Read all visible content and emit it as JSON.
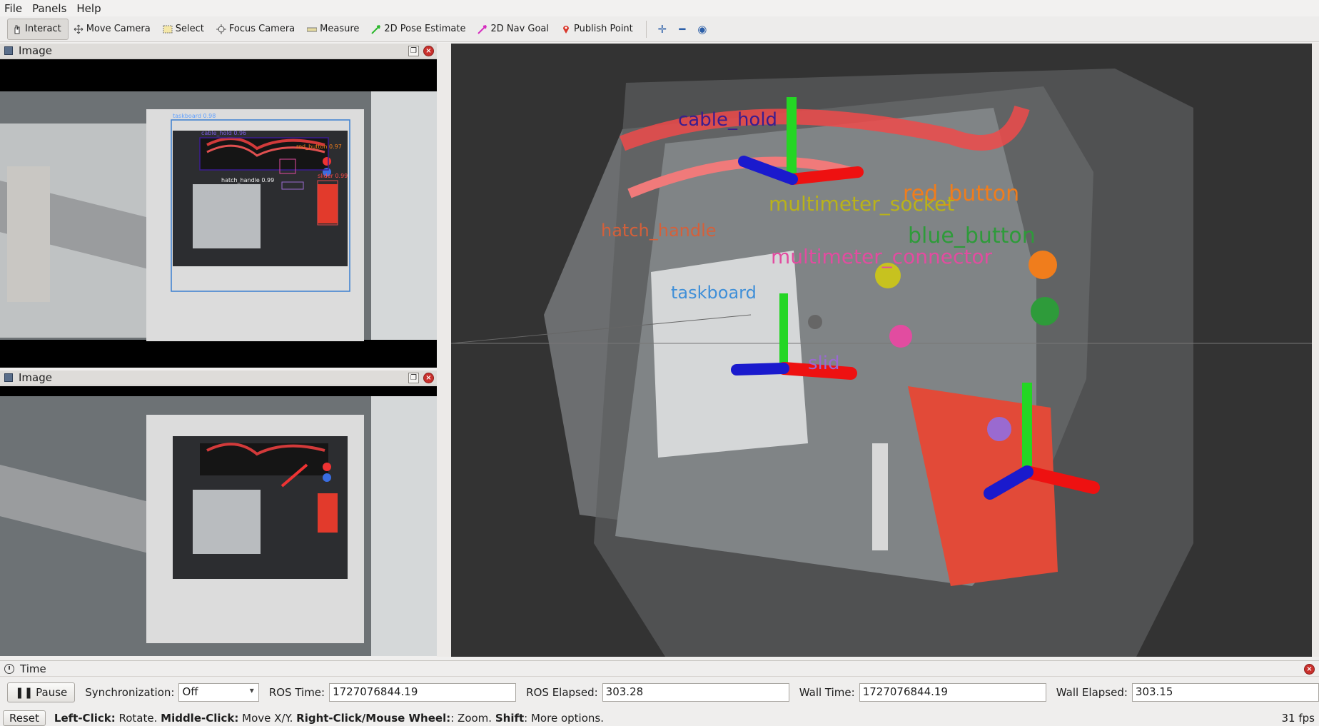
{
  "menubar": {
    "file": "File",
    "panels": "Panels",
    "help": "Help"
  },
  "toolbar": {
    "interact": "Interact",
    "move_camera": "Move Camera",
    "select": "Select",
    "focus_camera": "Focus Camera",
    "measure": "Measure",
    "pose_estimate": "2D Pose Estimate",
    "nav_goal": "2D Nav Goal",
    "publish_point": "Publish Point"
  },
  "panels": {
    "image_top": {
      "title": "Image"
    },
    "image_bottom": {
      "title": "Image"
    }
  },
  "viewport": {
    "labels": {
      "cable_hold": "cable_hold",
      "red_button": "red_button",
      "blue_button": "blue_button",
      "multimeter_socket": "multimeter_socket",
      "multimeter_connector": "multimeter_connector",
      "hatch_handle": "hatch_handle",
      "taskboard": "taskboard",
      "slider": "slid"
    },
    "colors": {
      "cable_hold": "#3b1d8f",
      "red_button": "#f07d1c",
      "blue_button": "#2e9b3a",
      "multimeter_socket": "#b9b21a",
      "multimeter_connector": "#e24ca0",
      "hatch_handle": "#d5603a",
      "taskboard": "#3f8fd8",
      "slider": "#9a6ad0"
    }
  },
  "time": {
    "title": "Time",
    "pause_label": "Pause",
    "sync_label": "Synchronization:",
    "sync_value": "Off",
    "ros_time_label": "ROS Time:",
    "ros_time": "1727076844.19",
    "ros_elapsed_label": "ROS Elapsed:",
    "ros_elapsed": "303.28",
    "wall_time_label": "Wall Time:",
    "wall_time": "1727076844.19",
    "wall_elapsed_label": "Wall Elapsed:",
    "wall_elapsed": "303.15"
  },
  "status": {
    "reset": "Reset",
    "left_click": "Left-Click:",
    "left_click_desc": " Rotate. ",
    "middle_click": "Middle-Click:",
    "middle_click_desc": " Move X/Y. ",
    "right_click": "Right-Click/Mouse Wheel:",
    "right_click_desc": ": Zoom. ",
    "shift": "Shift",
    "shift_desc": ": More options.",
    "fps": "31 fps"
  }
}
